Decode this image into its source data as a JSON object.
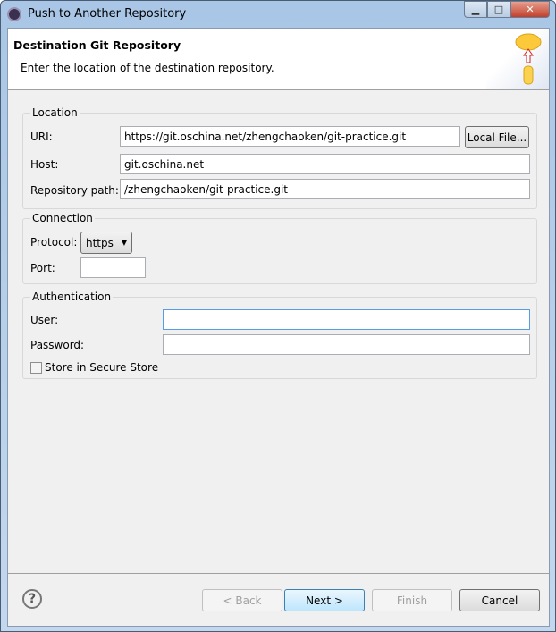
{
  "window": {
    "title": "Push to Another Repository"
  },
  "header": {
    "title": "Destination Git Repository",
    "description": "Enter the location of the destination repository."
  },
  "location": {
    "label": "Location",
    "uri_label": "URI:",
    "uri": "https://git.oschina.net/zhengchaoken/git-practice.git",
    "local_file": "Local File...",
    "host_label": "Host:",
    "host": "git.oschina.net",
    "path_label": "Repository path:",
    "path": "/zhengchaoken/git-practice.git"
  },
  "connection": {
    "label": "Connection",
    "protocol_label": "Protocol:",
    "protocol": "https",
    "port_label": "Port:",
    "port": ""
  },
  "auth": {
    "label": "Authentication",
    "user_label": "User:",
    "user": "",
    "password_label": "Password:",
    "password": "",
    "store_label": "Store in Secure Store",
    "store_checked": false
  },
  "footer": {
    "back": "< Back",
    "next": "Next >",
    "finish": "Finish",
    "cancel": "Cancel"
  }
}
